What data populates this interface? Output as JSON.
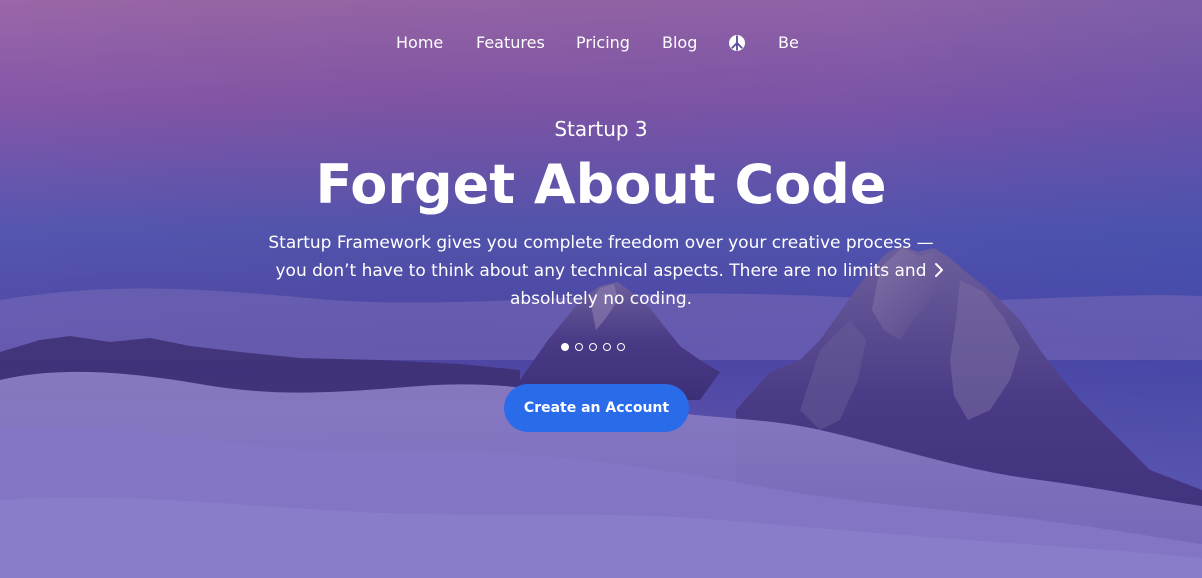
{
  "nav": {
    "items": [
      {
        "label": "Home"
      },
      {
        "label": "Features"
      },
      {
        "label": "Pricing"
      },
      {
        "label": "Blog"
      }
    ],
    "logo_icon": "peace-sign-icon",
    "extra_label": "Be"
  },
  "hero": {
    "subtitle": "Startup 3",
    "title": "Forget About Code",
    "description": "Startup Framework gives you complete freedom over your creative process — you don’t have to think about any technical aspects. There are no limits and absolutely no coding.",
    "next_icon": "chevron-right-icon",
    "slides": {
      "count": 5,
      "active": 1
    },
    "cta_label": "Create an Account"
  },
  "colors": {
    "cta_background": "#2a6bea",
    "text": "#ffffff"
  }
}
